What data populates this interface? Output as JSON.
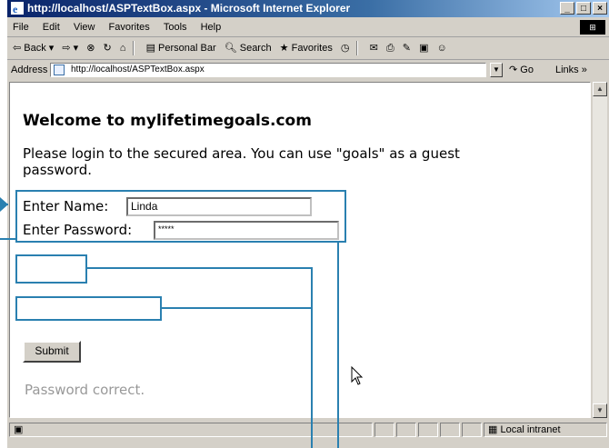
{
  "window": {
    "title": "http://localhost/ASPTextBox.aspx - Microsoft Internet Explorer",
    "buttons": [
      "_",
      "□",
      "×"
    ]
  },
  "menu": [
    "File",
    "Edit",
    "View",
    "Favorites",
    "Tools",
    "Help"
  ],
  "toolbar": {
    "back": "⇦ Back ▾",
    "forward": "⇨ ▾",
    "personal_bar": "Personal Bar",
    "search": "Search",
    "favorites": "Favorites"
  },
  "address": {
    "label": "Address",
    "url": "http://localhost/ASPTextBox.aspx",
    "go": "Go",
    "links": "Links »"
  },
  "page": {
    "heading": "Welcome to mylifetimegoals.com",
    "paragraph": "Please login to the secured area. You can use \"goals\" as a guest password.",
    "name_label": "Enter Name:",
    "name_value": "Linda",
    "password_label": "Enter Password:",
    "password_value": "*****",
    "submit_label": "Submit",
    "message": "Password correct."
  },
  "status": {
    "zone": "Local intranet"
  },
  "colors": {
    "callout": "#2a80b0",
    "message": "#999999"
  }
}
